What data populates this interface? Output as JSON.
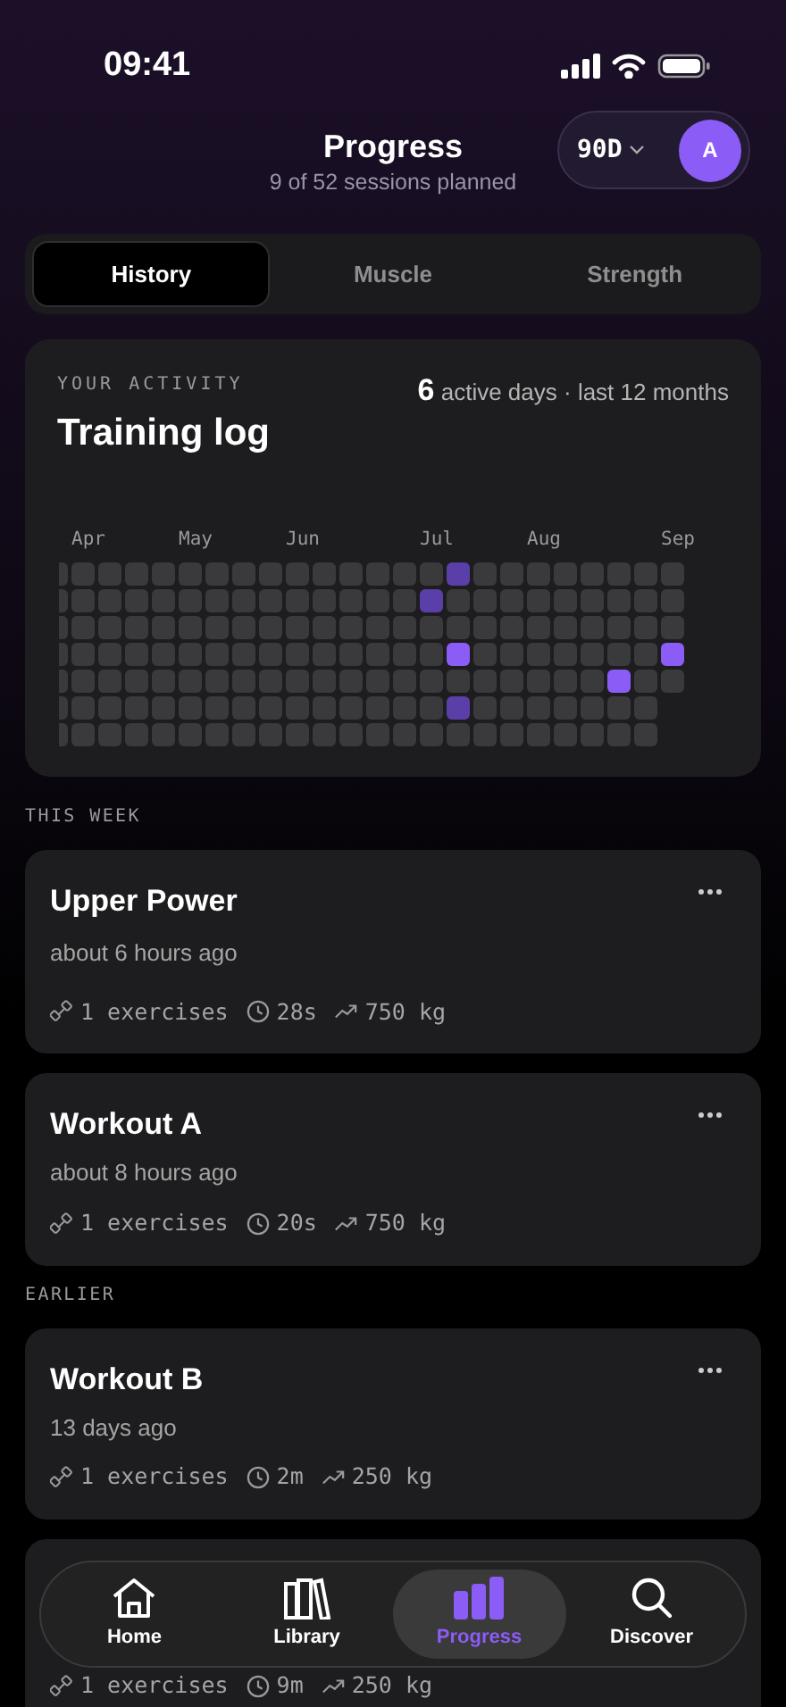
{
  "status_bar": {
    "time": "09:41"
  },
  "header": {
    "title": "Progress",
    "subtitle": "9 of 52 sessions planned",
    "range": "90D",
    "avatar": "A"
  },
  "tabs": [
    {
      "label": "History",
      "selected": true
    },
    {
      "label": "Muscle",
      "selected": false
    },
    {
      "label": "Strength",
      "selected": false
    }
  ],
  "activity": {
    "eyebrow": "YOUR ACTIVITY",
    "title": "Training log",
    "count": "6",
    "summary": "active days · last 12 months",
    "weeks": [
      {
        "days": [
          {
            "kind": "none"
          },
          {
            "kind": "none"
          },
          {
            "kind": "none"
          },
          {
            "kind": "none"
          },
          {
            "kind": "none"
          },
          {
            "kind": "none"
          },
          {
            "kind": "none"
          }
        ]
      },
      {
        "month": "Apr",
        "days": [
          {
            "kind": "none"
          },
          {
            "kind": "none"
          },
          {
            "kind": "none"
          },
          {
            "kind": "none"
          },
          {
            "kind": "none"
          },
          {
            "kind": "none"
          },
          {
            "kind": "none"
          }
        ]
      },
      {
        "days": [
          {
            "kind": "none"
          },
          {
            "kind": "none"
          },
          {
            "kind": "none"
          },
          {
            "kind": "none"
          },
          {
            "kind": "none"
          },
          {
            "kind": "none"
          },
          {
            "kind": "none"
          }
        ]
      },
      {
        "days": [
          {
            "kind": "none"
          },
          {
            "kind": "none"
          },
          {
            "kind": "none"
          },
          {
            "kind": "none"
          },
          {
            "kind": "none"
          },
          {
            "kind": "none"
          },
          {
            "kind": "none"
          }
        ]
      },
      {
        "days": [
          {
            "kind": "none"
          },
          {
            "kind": "none"
          },
          {
            "kind": "none"
          },
          {
            "kind": "none"
          },
          {
            "kind": "none"
          },
          {
            "kind": "none"
          },
          {
            "kind": "none"
          }
        ]
      },
      {
        "month": "May",
        "days": [
          {
            "kind": "none"
          },
          {
            "kind": "none"
          },
          {
            "kind": "none"
          },
          {
            "kind": "none"
          },
          {
            "kind": "none"
          },
          {
            "kind": "none"
          },
          {
            "kind": "none"
          }
        ]
      },
      {
        "days": [
          {
            "kind": "none"
          },
          {
            "kind": "none"
          },
          {
            "kind": "none"
          },
          {
            "kind": "none"
          },
          {
            "kind": "none"
          },
          {
            "kind": "none"
          },
          {
            "kind": "none"
          }
        ]
      },
      {
        "days": [
          {
            "kind": "none"
          },
          {
            "kind": "none"
          },
          {
            "kind": "none"
          },
          {
            "kind": "none"
          },
          {
            "kind": "none"
          },
          {
            "kind": "none"
          },
          {
            "kind": "none"
          }
        ]
      },
      {
        "days": [
          {
            "kind": "none"
          },
          {
            "kind": "none"
          },
          {
            "kind": "none"
          },
          {
            "kind": "none"
          },
          {
            "kind": "none"
          },
          {
            "kind": "none"
          },
          {
            "kind": "none"
          }
        ]
      },
      {
        "month": "Jun",
        "days": [
          {
            "kind": "none"
          },
          {
            "kind": "none"
          },
          {
            "kind": "none"
          },
          {
            "kind": "none"
          },
          {
            "kind": "none"
          },
          {
            "kind": "none"
          },
          {
            "kind": "none"
          }
        ]
      },
      {
        "days": [
          {
            "kind": "none"
          },
          {
            "kind": "none"
          },
          {
            "kind": "none"
          },
          {
            "kind": "none"
          },
          {
            "kind": "none"
          },
          {
            "kind": "none"
          },
          {
            "kind": "none"
          }
        ]
      },
      {
        "days": [
          {
            "kind": "none"
          },
          {
            "kind": "none"
          },
          {
            "kind": "none"
          },
          {
            "kind": "none"
          },
          {
            "kind": "none"
          },
          {
            "kind": "none"
          },
          {
            "kind": "none"
          }
        ]
      },
      {
        "days": [
          {
            "kind": "none"
          },
          {
            "kind": "none"
          },
          {
            "kind": "none"
          },
          {
            "kind": "none"
          },
          {
            "kind": "none"
          },
          {
            "kind": "none"
          },
          {
            "kind": "none"
          }
        ]
      },
      {
        "days": [
          {
            "kind": "none"
          },
          {
            "kind": "none"
          },
          {
            "kind": "none"
          },
          {
            "kind": "none"
          },
          {
            "kind": "none"
          },
          {
            "kind": "none"
          },
          {
            "kind": "none"
          }
        ]
      },
      {
        "month": "Jul",
        "days": [
          {
            "kind": "none"
          },
          {
            "kind": "low"
          },
          {
            "kind": "none"
          },
          {
            "kind": "none"
          },
          {
            "kind": "none"
          },
          {
            "kind": "none"
          },
          {
            "kind": "none"
          }
        ]
      },
      {
        "days": [
          {
            "kind": "low"
          },
          {
            "kind": "none"
          },
          {
            "kind": "none"
          },
          {
            "kind": "high"
          },
          {
            "kind": "none"
          },
          {
            "kind": "low"
          },
          {
            "kind": "none"
          }
        ]
      },
      {
        "days": [
          {
            "kind": "none"
          },
          {
            "kind": "none"
          },
          {
            "kind": "none"
          },
          {
            "kind": "none"
          },
          {
            "kind": "none"
          },
          {
            "kind": "none"
          },
          {
            "kind": "none"
          }
        ]
      },
      {
        "days": [
          {
            "kind": "none"
          },
          {
            "kind": "none"
          },
          {
            "kind": "none"
          },
          {
            "kind": "none"
          },
          {
            "kind": "none"
          },
          {
            "kind": "none"
          },
          {
            "kind": "none"
          }
        ]
      },
      {
        "month": "Aug",
        "days": [
          {
            "kind": "none"
          },
          {
            "kind": "none"
          },
          {
            "kind": "none"
          },
          {
            "kind": "none"
          },
          {
            "kind": "none"
          },
          {
            "kind": "none"
          },
          {
            "kind": "none"
          }
        ]
      },
      {
        "days": [
          {
            "kind": "none"
          },
          {
            "kind": "none"
          },
          {
            "kind": "none"
          },
          {
            "kind": "none"
          },
          {
            "kind": "none"
          },
          {
            "kind": "none"
          },
          {
            "kind": "none"
          }
        ]
      },
      {
        "days": [
          {
            "kind": "none"
          },
          {
            "kind": "none"
          },
          {
            "kind": "none"
          },
          {
            "kind": "none"
          },
          {
            "kind": "none"
          },
          {
            "kind": "none"
          },
          {
            "kind": "none"
          }
        ]
      },
      {
        "days": [
          {
            "kind": "none"
          },
          {
            "kind": "none"
          },
          {
            "kind": "none"
          },
          {
            "kind": "none"
          },
          {
            "kind": "high"
          },
          {
            "kind": "none"
          },
          {
            "kind": "none"
          }
        ]
      },
      {
        "days": [
          {
            "kind": "none"
          },
          {
            "kind": "none"
          },
          {
            "kind": "none"
          },
          {
            "kind": "none"
          },
          {
            "kind": "none"
          },
          {
            "kind": "none"
          },
          {
            "kind": "none"
          }
        ]
      },
      {
        "month": "Sep",
        "days": [
          {
            "kind": "none"
          },
          {
            "kind": "none"
          },
          {
            "kind": "none"
          },
          {
            "kind": "high"
          },
          {
            "kind": "none"
          }
        ]
      }
    ]
  },
  "sections": [
    {
      "heading": "THIS WEEK",
      "workouts": [
        {
          "title": "Upper Power",
          "time": "about 6 hours ago",
          "exercises": "1 exercises",
          "duration": "28s",
          "volume": "750 kg"
        },
        {
          "title": "Workout A",
          "time": "about 8 hours ago",
          "exercises": "1 exercises",
          "duration": "20s",
          "volume": "750 kg"
        }
      ]
    },
    {
      "heading": "EARLIER",
      "workouts": [
        {
          "title": "Workout B",
          "time": "13 days ago",
          "exercises": "1 exercises",
          "duration": "2m",
          "volume": "250 kg"
        },
        {
          "exercises": "1 exercises",
          "duration": "9m",
          "volume": "250 kg"
        }
      ]
    }
  ],
  "nav": [
    {
      "label": "Home",
      "selected": false
    },
    {
      "label": "Library",
      "selected": false
    },
    {
      "label": "Progress",
      "selected": true
    },
    {
      "label": "Discover",
      "selected": false
    }
  ]
}
